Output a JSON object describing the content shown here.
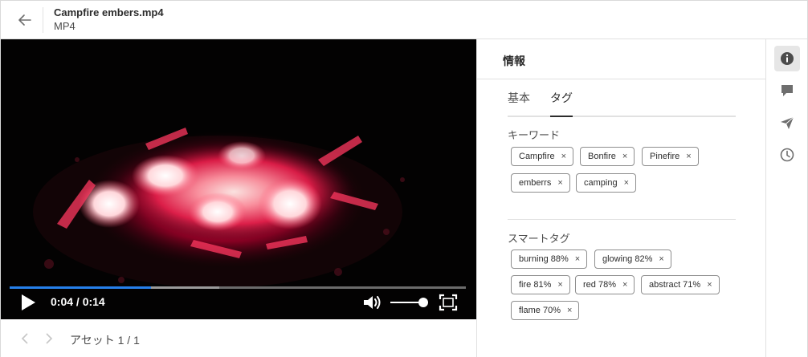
{
  "header": {
    "title": "Campfire embers.mp4",
    "subtitle": "MP4"
  },
  "player": {
    "time": "0:04 / 0:14",
    "progress": 0.31,
    "buffered": 0.46,
    "volume": 0.9,
    "colors": {
      "progress": "#2680eb",
      "background": "#000000"
    }
  },
  "footer": {
    "asset_count": "アセット 1 / 1"
  },
  "panel": {
    "title": "情報",
    "tabs": [
      {
        "label": "基本",
        "selected": false
      },
      {
        "label": "タグ",
        "selected": true
      }
    ],
    "keywords": {
      "label": "キーワード",
      "tags": [
        "Campfire",
        "Bonfire",
        "Pinefire",
        "emberrs",
        "camping"
      ]
    },
    "smart_tags": {
      "label": "スマートタグ",
      "tags": [
        "burning 88%",
        "glowing 82%",
        "fire 81%",
        "red 78%",
        "abstract 71%",
        "flame 70%"
      ]
    },
    "remove_glyph": "×"
  },
  "rail": {
    "icons": [
      "info-icon",
      "comment-icon",
      "send-icon",
      "history-icon"
    ],
    "active": "info-icon"
  }
}
